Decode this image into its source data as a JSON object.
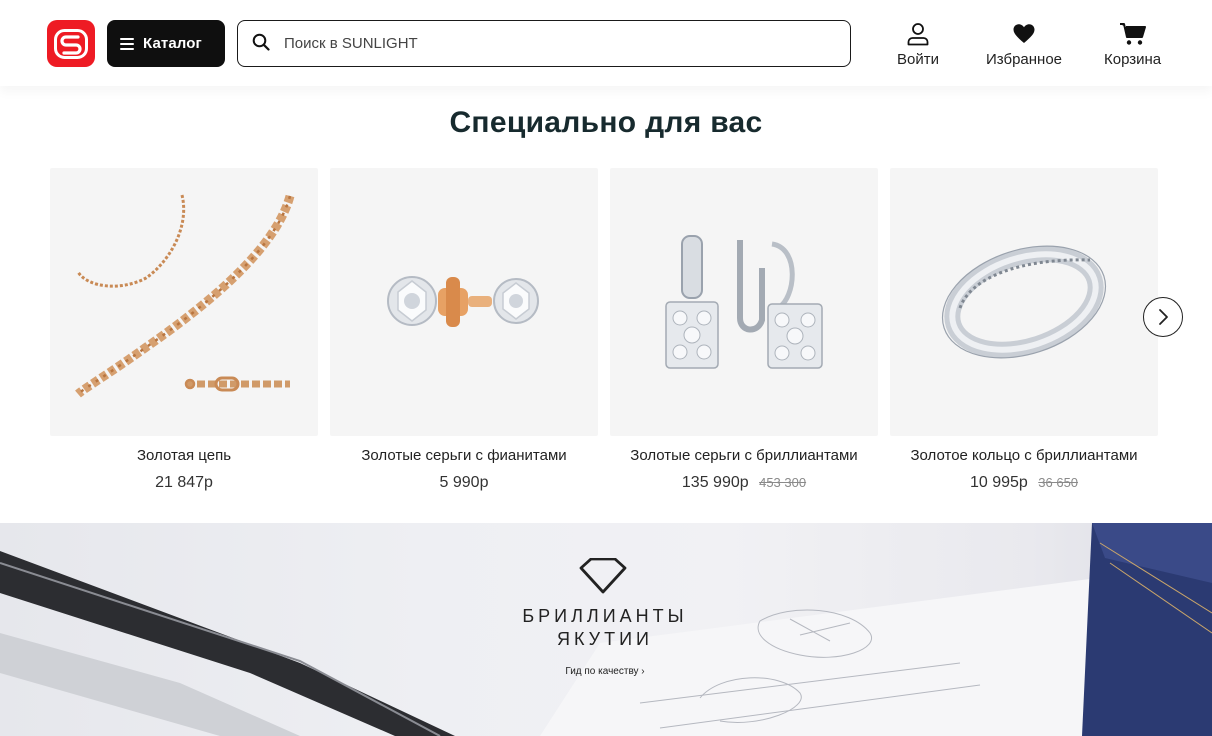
{
  "header": {
    "catalog_label": "Каталог",
    "search_placeholder": "Поиск в SUNLIGHT",
    "login_label": "Войти",
    "favorites_label": "Избранное",
    "cart_label": "Корзина",
    "brand_color": "#ee1b24"
  },
  "section": {
    "title": "Специально для вас"
  },
  "products": [
    {
      "name": "Золотая цепь",
      "price": "21 847р",
      "old_price": ""
    },
    {
      "name": "Золотые серьги с фианитами",
      "price": "5 990р",
      "old_price": ""
    },
    {
      "name": "Золотые серьги с бриллиантами",
      "price": "135 990р",
      "old_price": "453 300"
    },
    {
      "name": "Золотое кольцо с бриллиантами",
      "price": "10 995р",
      "old_price": "36 650"
    }
  ],
  "banner": {
    "title_line1": "БРИЛЛИАНТЫ",
    "title_line2": "ЯКУТИИ",
    "link_label": "Гид по качеству ›"
  },
  "icons": [
    "logo-icon",
    "menu-icon",
    "search-icon",
    "user-icon",
    "heart-icon",
    "cart-icon",
    "chevron-right-icon",
    "diamond-icon"
  ]
}
